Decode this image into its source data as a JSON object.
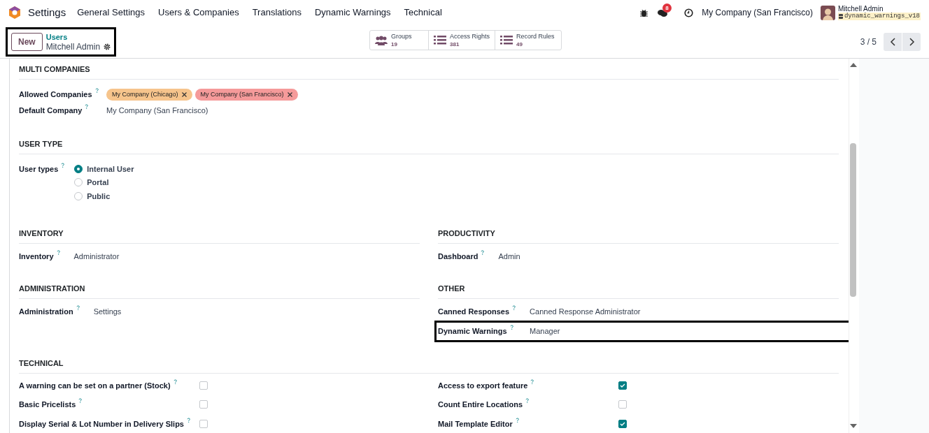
{
  "navbar": {
    "app_name": "Settings",
    "menu": [
      "General Settings",
      "Users & Companies",
      "Translations",
      "Dynamic Warnings",
      "Technical"
    ],
    "chat_count": "8",
    "company": "My Company (San Francisco)",
    "user_name": "Mitchell Admin",
    "database": "dynamic_warnings_v18"
  },
  "control_panel": {
    "highlighted": true,
    "new_button": "New",
    "breadcrumb_parent": "Users",
    "record_name": "Mitchell Admin",
    "smart_buttons": [
      {
        "kind": "groups",
        "label": "Groups",
        "count": "19"
      },
      {
        "kind": "list",
        "label": "Access Rights",
        "count": "381"
      },
      {
        "kind": "list",
        "label": "Record Rules",
        "count": "49"
      }
    ],
    "pager": "3 / 5"
  },
  "multi_companies": {
    "title": "MULTI COMPANIES",
    "allowed_label": "Allowed Companies",
    "tags": [
      {
        "text": "My Company (Chicago)",
        "color": "#f6c48c"
      },
      {
        "text": "My Company (San Francisco)",
        "color": "#f59a9a"
      }
    ],
    "default_label": "Default Company",
    "default_value": "My Company (San Francisco)"
  },
  "user_type": {
    "title": "USER TYPE",
    "label": "User types",
    "options": [
      {
        "label": "Internal User",
        "selected": true
      },
      {
        "label": "Portal",
        "selected": false
      },
      {
        "label": "Public",
        "selected": false
      }
    ]
  },
  "section_rows": [
    {
      "left": {
        "title": "INVENTORY",
        "fields": [
          {
            "label": "Inventory",
            "value": "Administrator",
            "highlighted": false
          }
        ]
      },
      "right": {
        "title": "PRODUCTIVITY",
        "fields": [
          {
            "label": "Dashboard",
            "value": "Admin",
            "highlighted": false
          }
        ]
      }
    },
    {
      "left": {
        "title": "ADMINISTRATION",
        "fields": [
          {
            "label": "Administration",
            "value": "Settings",
            "highlighted": false
          }
        ]
      },
      "right": {
        "title": "OTHER",
        "fields": [
          {
            "label": "Canned Responses",
            "value": "Canned Response Administrator",
            "highlighted": false
          },
          {
            "label": "Dynamic Warnings",
            "value": "Manager",
            "highlighted": true
          }
        ]
      }
    }
  ],
  "technical": {
    "title": "TECHNICAL",
    "left": [
      {
        "label": "A warning can be set on a partner (Stock)",
        "checked": false
      },
      {
        "label": "Basic Pricelists",
        "checked": false
      },
      {
        "label": "Display Serial & Lot Number in Delivery Slips",
        "checked": false
      }
    ],
    "right": [
      {
        "label": "Access to export feature",
        "checked": true
      },
      {
        "label": "Count Entire Locations",
        "checked": false
      },
      {
        "label": "Mail Template Editor",
        "checked": true
      }
    ]
  }
}
